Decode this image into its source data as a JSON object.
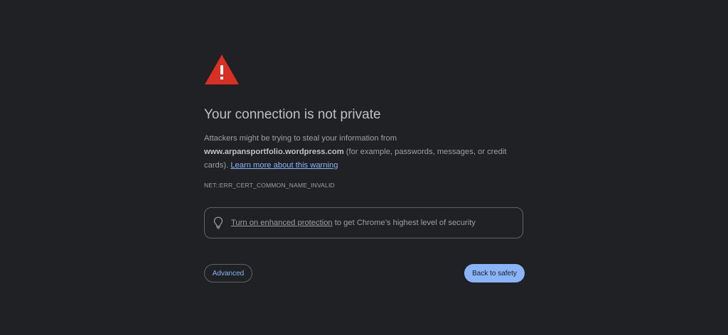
{
  "page": {
    "title": "Your connection is not private",
    "message_before": "Attackers might be trying to steal your information from ",
    "domain": "www.arpansportfolio.wordpress.com",
    "message_after": " (for example, passwords, messages, or credit cards). ",
    "learn_more_link": "Learn more about this warning",
    "error_code": "NET::ERR_CERT_COMMON_NAME_INVALID"
  },
  "protection": {
    "icon": "lightbulb-icon",
    "link_text": "Turn on enhanced protection",
    "text": " to get Chrome’s highest level of security"
  },
  "buttons": {
    "advanced": "Advanced",
    "back_to_safety": "Back to safety"
  },
  "colors": {
    "background": "#202124",
    "warning_red": "#d93025",
    "link_blue": "#8ab4f8",
    "text_primary": "#bdc1c6",
    "text_secondary": "#9aa0a6"
  }
}
